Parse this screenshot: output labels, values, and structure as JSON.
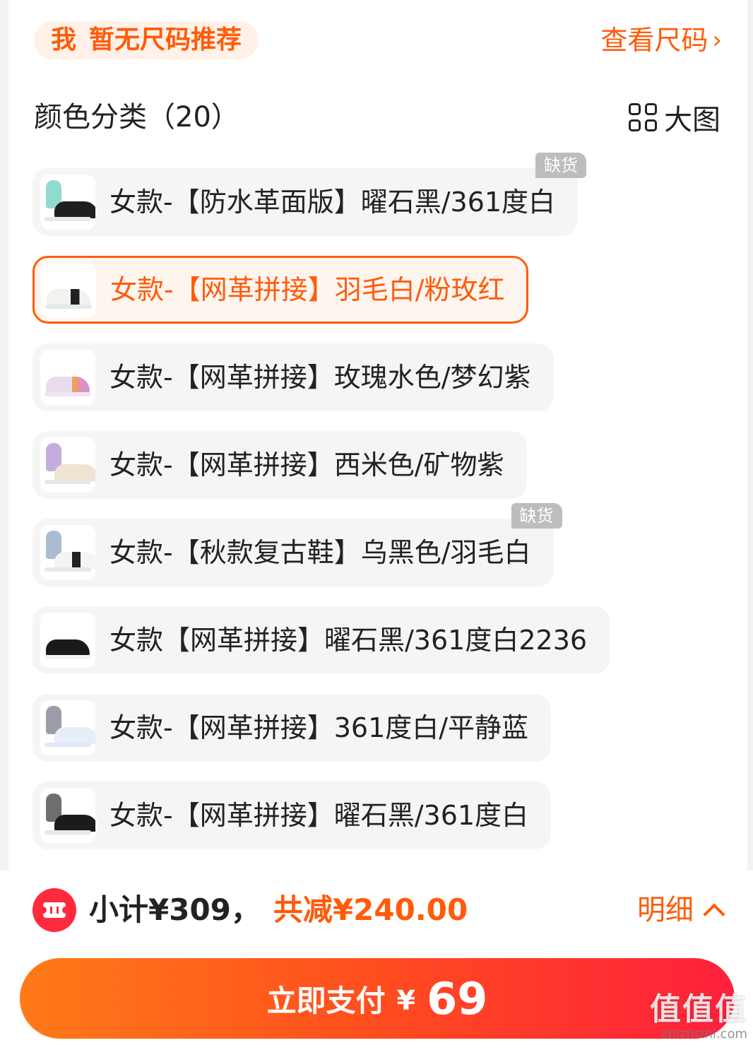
{
  "size_recommendation": {
    "prefix": "我",
    "text": "暂无尺码推荐",
    "link_label": "查看尺码",
    "link_chevron": "›"
  },
  "color_section": {
    "title": "颜色分类（20）",
    "big_view_label": "大图",
    "big_view_icon": "grid-icon"
  },
  "options": [
    {
      "label": "女款-【防水革面版】曜石黑/361度白",
      "badge": "缺货",
      "selected": false,
      "thumb": "shoe-black-with-model"
    },
    {
      "label": "女款-【网革拼接】羽毛白/粉玫红",
      "badge": "",
      "selected": true,
      "thumb": "shoe-white-black"
    },
    {
      "label": "女款-【网革拼接】玫瑰水色/梦幻紫",
      "badge": "",
      "selected": false,
      "thumb": "shoe-lilac"
    },
    {
      "label": "女款-【网革拼接】西米色/矿物紫",
      "badge": "",
      "selected": false,
      "thumb": "shoe-beige-with-model"
    },
    {
      "label": "女款-【秋款复古鞋】乌黑色/羽毛白",
      "badge": "缺货",
      "selected": false,
      "thumb": "shoe-retro-with-model"
    },
    {
      "label": "女款【网革拼接】曜石黑/361度白2236",
      "badge": "",
      "selected": false,
      "thumb": "shoe-black"
    },
    {
      "label": "女款-【网革拼接】361度白/平静蓝",
      "badge": "",
      "selected": false,
      "thumb": "shoe-white-blue-with-model"
    },
    {
      "label": "女款-【网革拼接】曜石黑/361度白",
      "badge": "",
      "selected": false,
      "thumb": "shoe-black-with-model"
    }
  ],
  "footer": {
    "coupon_icon": "coupon-ticket-icon",
    "subtotal": "小计¥309，",
    "discount": "共减¥240.00",
    "detail_label": "明细",
    "pay_label": "立即支付",
    "pay_currency": "¥",
    "pay_amount": "69"
  },
  "watermark": {
    "main": "值值值",
    "sub": "zhizhizhi.com"
  },
  "colors": {
    "accent": "#ff5b0a",
    "badge_bg": "#bdbdbd",
    "coupon_red": "#ff2a3d"
  }
}
